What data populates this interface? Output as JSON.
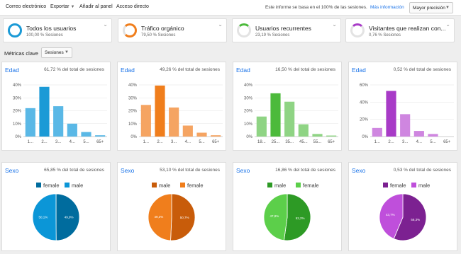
{
  "toolbar": {
    "email": "Correo electrónico",
    "export": "Exportar",
    "add_dashboard": "Añadir al panel",
    "shortcut": "Acceso directo",
    "info": "Este informe se basa en el 100% de las sesiones.",
    "more_info": "Más información",
    "precision": "Mayor precisión"
  },
  "segments": [
    {
      "title": "Todos los usuarios",
      "subtitle": "100,00 % Sesiones",
      "color": "#1b9ad6",
      "fraction": 1.0
    },
    {
      "title": "Tráfico orgánico",
      "subtitle": "79,50 % Sesiones",
      "color": "#f07e1c",
      "fraction": 0.795
    },
    {
      "title": "Usuarios recurrentes",
      "subtitle": "23,19 % Sesiones",
      "color": "#4cba3b",
      "fraction": 0.2319
    },
    {
      "title": "Visitantes que realizan con...",
      "subtitle": "0,76 % Sesiones",
      "color": "#a83bc7",
      "fraction": 0.0076
    }
  ],
  "metrics": {
    "label": "Métricas clave",
    "selected": "Sesiones"
  },
  "chart_data": [
    {
      "type": "bar",
      "title": "Edad",
      "subtitle": "61,72 % del total de sesiones",
      "color": "#1b9ad6",
      "light_color": "#5ab8e6",
      "categories": [
        "1...",
        "2...",
        "3...",
        "4...",
        "5...",
        "65+"
      ],
      "values": [
        22,
        38.5,
        23.5,
        10,
        3.5,
        1
      ],
      "ylim": [
        0,
        40
      ],
      "yticks": [
        "0%",
        "10%",
        "20%",
        "30%",
        "40%"
      ]
    },
    {
      "type": "bar",
      "title": "Edad",
      "subtitle": "49,26 % del total de sesiones",
      "color": "#f07e1c",
      "light_color": "#f5a462",
      "categories": [
        "1...",
        "2...",
        "3...",
        "4...",
        "5...",
        "65+"
      ],
      "values": [
        24.5,
        39.5,
        22.5,
        8.5,
        3,
        1
      ],
      "ylim": [
        0,
        40
      ],
      "yticks": [
        "0%",
        "10%",
        "20%",
        "30%",
        "40%"
      ]
    },
    {
      "type": "bar",
      "title": "Edad",
      "subtitle": "16,50 % del total de sesiones",
      "color": "#4cba3b",
      "light_color": "#8fd484",
      "categories": [
        "18...",
        "25...",
        "35...",
        "45...",
        "55...",
        "65+"
      ],
      "values": [
        15.5,
        33.5,
        27,
        9.5,
        2,
        0.8
      ],
      "ylim": [
        0,
        40
      ],
      "yticks": [
        "0%",
        "10%",
        "20%",
        "30%",
        "40%"
      ]
    },
    {
      "type": "bar",
      "title": "Edad",
      "subtitle": "0,52 % del total de sesiones",
      "color": "#a83bc7",
      "light_color": "#cf86e0",
      "categories": [
        "1...",
        "2...",
        "3...",
        "4...",
        "5...",
        "65+"
      ],
      "values": [
        10,
        53,
        26,
        6.5,
        3,
        0
      ],
      "ylim": [
        0,
        60
      ],
      "yticks": [
        "0%",
        "20%",
        "40%",
        "60%"
      ]
    },
    {
      "type": "pie",
      "title": "Sexo",
      "subtitle": "65,85 % del total de sesiones",
      "slices": [
        {
          "name": "female",
          "value": 49.9,
          "label": "49,9%",
          "color": "#006c9e"
        },
        {
          "name": "male",
          "value": 50.1,
          "label": "50,1%",
          "color": "#0b96d7"
        }
      ]
    },
    {
      "type": "pie",
      "title": "Sexo",
      "subtitle": "53,10 % del total de sesiones",
      "slices": [
        {
          "name": "male",
          "value": 50.7,
          "label": "50,7%",
          "color": "#c85c0a"
        },
        {
          "name": "female",
          "value": 49.3,
          "label": "49,3%",
          "color": "#f07e1c"
        }
      ]
    },
    {
      "type": "pie",
      "title": "Sexo",
      "subtitle": "16,86 % del total de sesiones",
      "slices": [
        {
          "name": "male",
          "value": 52.2,
          "label": "52,2%",
          "color": "#2d9a25"
        },
        {
          "name": "female",
          "value": 47.8,
          "label": "47,8%",
          "color": "#5ccf4a"
        }
      ]
    },
    {
      "type": "pie",
      "title": "Sexo",
      "subtitle": "0,53 % del total de sesiones",
      "slices": [
        {
          "name": "female",
          "value": 56.3,
          "label": "56,3%",
          "color": "#7c2191"
        },
        {
          "name": "male",
          "value": 43.7,
          "label": "43,7%",
          "color": "#bf4fdb"
        }
      ]
    }
  ]
}
